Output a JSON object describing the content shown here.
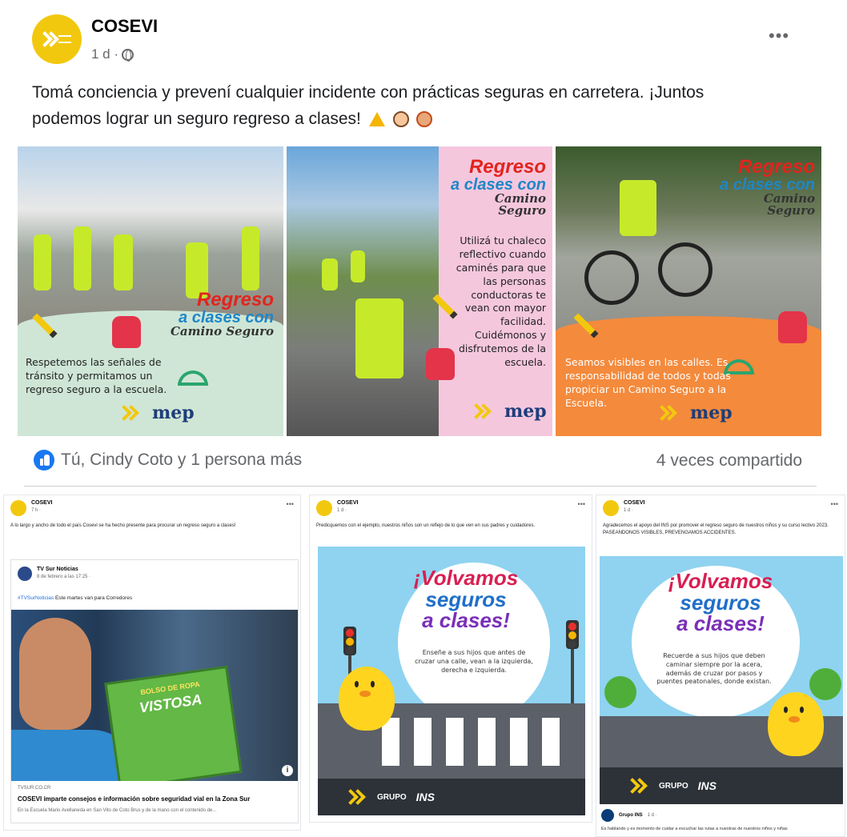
{
  "main_post": {
    "page_name": "COSEVI",
    "time": "1 d ·",
    "text": "Tomá conciencia y prevení cualquier incidente con prácticas seguras en carretera. ¡Juntos podemos lograr un seguro regreso a clases!",
    "emojis": [
      "warning-icon",
      "face-icon",
      "face-icon"
    ],
    "images": [
      {
        "title_line1": "Regreso",
        "title_line2": "a clases con",
        "title_line3": "Camino Seguro",
        "caption": "Respetemos las señales de tránsito y permitamos un regreso seguro a la escuela."
      },
      {
        "title_line1": "Regreso",
        "title_line2": "a clases con",
        "title_line3": "Camino Seguro",
        "caption": "Utilizá tu chaleco reflectivo cuando caminés para que las personas conductoras te vean con mayor facilidad. Cuidémonos y disfrutemos de la escuela."
      },
      {
        "title_line1": "Regreso",
        "title_line2": "a clases con",
        "title_line3": "Camino Seguro",
        "caption": "Seamos visibles en las calles. Es responsabilidad de todos y todas propiciar un Camino Seguro a la Escuela."
      }
    ],
    "logo_mep": "mep",
    "reactions": "Tú, Cindy Coto y 1 persona más",
    "shares": "4 veces compartido"
  },
  "mini_posts": [
    {
      "name": "COSEVI",
      "meta": "7 h ·",
      "text": "A lo largo y ancho de todo el país Cosevi se ha hecho presente para procurar un regreso seguro a clases!",
      "shared": {
        "name": "TV Sur Noticias",
        "meta": "8 de febrero a las 17:25 ·",
        "tag": "#TVSurNoticias",
        "tag_text": "Este martes van para Corredores",
        "book_line1": "BOLSO DE ROPA",
        "book_line2": "VISTOSA",
        "source": "TVSUR.CO.CR",
        "title": "COSEVI imparte consejos e información sobre seguridad vial en la Zona Sur",
        "desc": "En la Escuela Mario Avellaneda en San Vito de Coto Brus y de la mano con el contenido de..."
      }
    },
    {
      "name": "COSEVI",
      "meta": "1 d ·",
      "text": "Predicquemos con el ejemplo, nuestros niños son un reflejo de lo que ven en sus padres y cuidadores.",
      "headline": [
        "¡Volvamos",
        "seguros",
        "a clases!"
      ],
      "bubble": "Enseñe a sus hijos que antes de cruzar una calle, vean a la izquierda, derecha e izquierda.",
      "footer_brand": "GRUPO",
      "footer_ins": "INS"
    },
    {
      "name": "COSEVI",
      "meta": "1 d ·",
      "text": "Agradecemos el apoyo del INS por promover el regreso seguro de nuestros niños y su curso lectivo 2023.",
      "text2": "PASEANDONOS VISIBLES, PREVENGAMOS ACCIDENTES.",
      "headline": [
        "¡Volvamos",
        "seguros",
        "a clases!"
      ],
      "bubble": "Recuerde a sus hijos que deben caminar siempre por la acera, además de cruzar por pasos y puentes peatonales, donde existan.",
      "footer_brand": "GRUPO",
      "footer_ins": "INS",
      "comment_name": "Grupo INS",
      "comment_meta": "1 d ·",
      "comment_text": "Es hablando y es momento de cuidar a escuchar las rutas a nuestras de nuestros niños y niñas"
    }
  ],
  "colors": {
    "brand_yellow": "#f2c80f",
    "like_blue": "#1877f2",
    "regreso_red": "#e2241d",
    "panel_green": "#cfe6d6",
    "panel_pink": "#f5c7dd",
    "panel_orange": "#f48a3c"
  }
}
